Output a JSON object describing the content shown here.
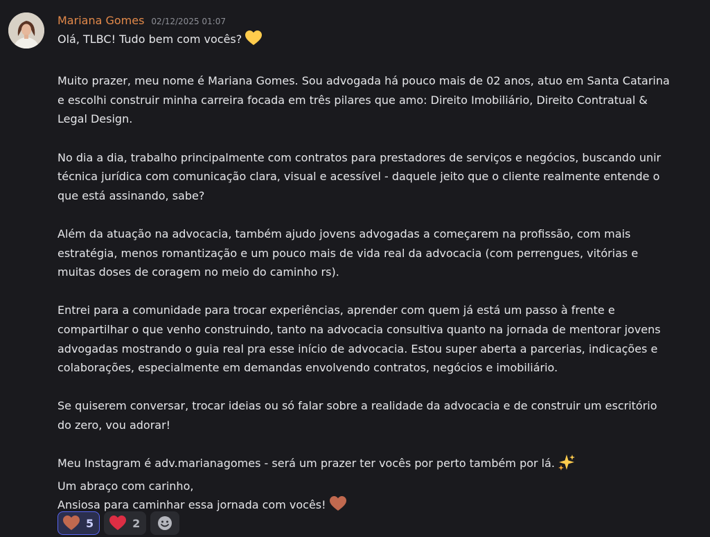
{
  "message": {
    "author": "Mariana Gomes",
    "timestamp": "02/12/2025 01:07",
    "paragraphs": [
      [
        "Olá, TLBC! Tudo bem com vocês?"
      ],
      [
        "Muito prazer, meu nome é Mariana Gomes. Sou advogada há pouco mais de 02 anos, atuo em Santa Catarina",
        "e escolhi construir minha carreira focada em três pilares que amo: Direito Imobiliário, Direito Contratual &",
        "Legal Design."
      ],
      [
        "No dia a dia, trabalho principalmente com contratos para prestadores de serviços e negócios, buscando unir",
        "técnica jurídica com comunicação clara, visual e acessível - daquele jeito que o cliente realmente entende o",
        "que está assinando, sabe?"
      ],
      [
        "Além da atuação na advocacia, também ajudo jovens advogadas a começarem na profissão, com mais",
        "estratégia, menos romantização e um pouco mais de vida real da advocacia (com perrengues, vitórias e",
        "muitas doses de coragem no meio do caminho rs)."
      ],
      [
        "Entrei para a comunidade para trocar experiências, aprender com quem já está um passo à frente e",
        "compartilhar o que venho construindo, tanto na advocacia consultiva quanto na jornada de mentorar jovens",
        "advogadas mostrando o guia real pra esse início de advocacia. Estou super aberta a parcerias, indicações e",
        "colaborações, especialmente em demandas envolvendo contratos, negócios e imobiliário."
      ],
      [
        "Se quiserem conversar, trocar ideias ou só falar sobre a realidade da advocacia e de construir um escritório",
        "do zero, vou adorar!"
      ],
      [
        "Meu Instagram é adv.marianagomes - será um prazer ter vocês por perto também por lá.",
        "Um abraço com carinho,",
        "Ansiosa para caminhar essa jornada com vocês!"
      ]
    ]
  },
  "inline_emojis": {
    "greeting": "yellow-heart-icon",
    "instagram": "sparkles-icon",
    "closing": "brown-heart-icon"
  },
  "reactions": [
    {
      "emoji": "brown-heart-icon",
      "count": "5",
      "reacted": true
    },
    {
      "emoji": "red-heart-icon",
      "count": "2",
      "reacted": false
    }
  ],
  "add_reaction": {
    "icon": "add-reaction-smiley-icon"
  },
  "colors": {
    "background": "#1a1a1e",
    "author": "#e2894a",
    "timestamp": "#8d8f96",
    "text": "#e6e7ea",
    "reaction_active_border": "#5865f2",
    "yellow_heart": "#ffcc4d",
    "red_heart": "#dd2e44",
    "brown_heart": "#c1694f"
  }
}
